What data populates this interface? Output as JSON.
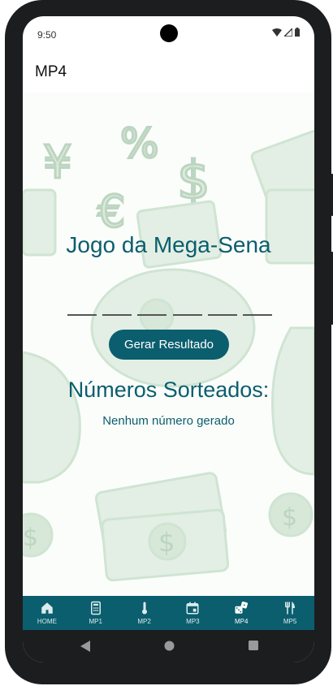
{
  "status_bar": {
    "time": "9:50"
  },
  "app_bar": {
    "title": "MP4"
  },
  "game": {
    "title": "Jogo da Mega-Sena",
    "slots": [
      "",
      "",
      "",
      "",
      "",
      ""
    ],
    "generate_label": "Gerar Resultado",
    "drawn_title": "Números Sorteados:",
    "drawn_status": "Nenhum número gerado"
  },
  "bottom_nav": {
    "active": "MP4",
    "items": [
      {
        "label": "HOME",
        "icon": "home-icon"
      },
      {
        "label": "MP1",
        "icon": "calculator-icon"
      },
      {
        "label": "MP2",
        "icon": "thermometer-icon"
      },
      {
        "label": "MP3",
        "icon": "calendar-icon"
      },
      {
        "label": "MP4",
        "icon": "dice-icon"
      },
      {
        "label": "MP5",
        "icon": "restaurant-icon"
      }
    ]
  },
  "colors": {
    "accent": "#0b5e6e",
    "background_art": "#cfe4d2"
  }
}
